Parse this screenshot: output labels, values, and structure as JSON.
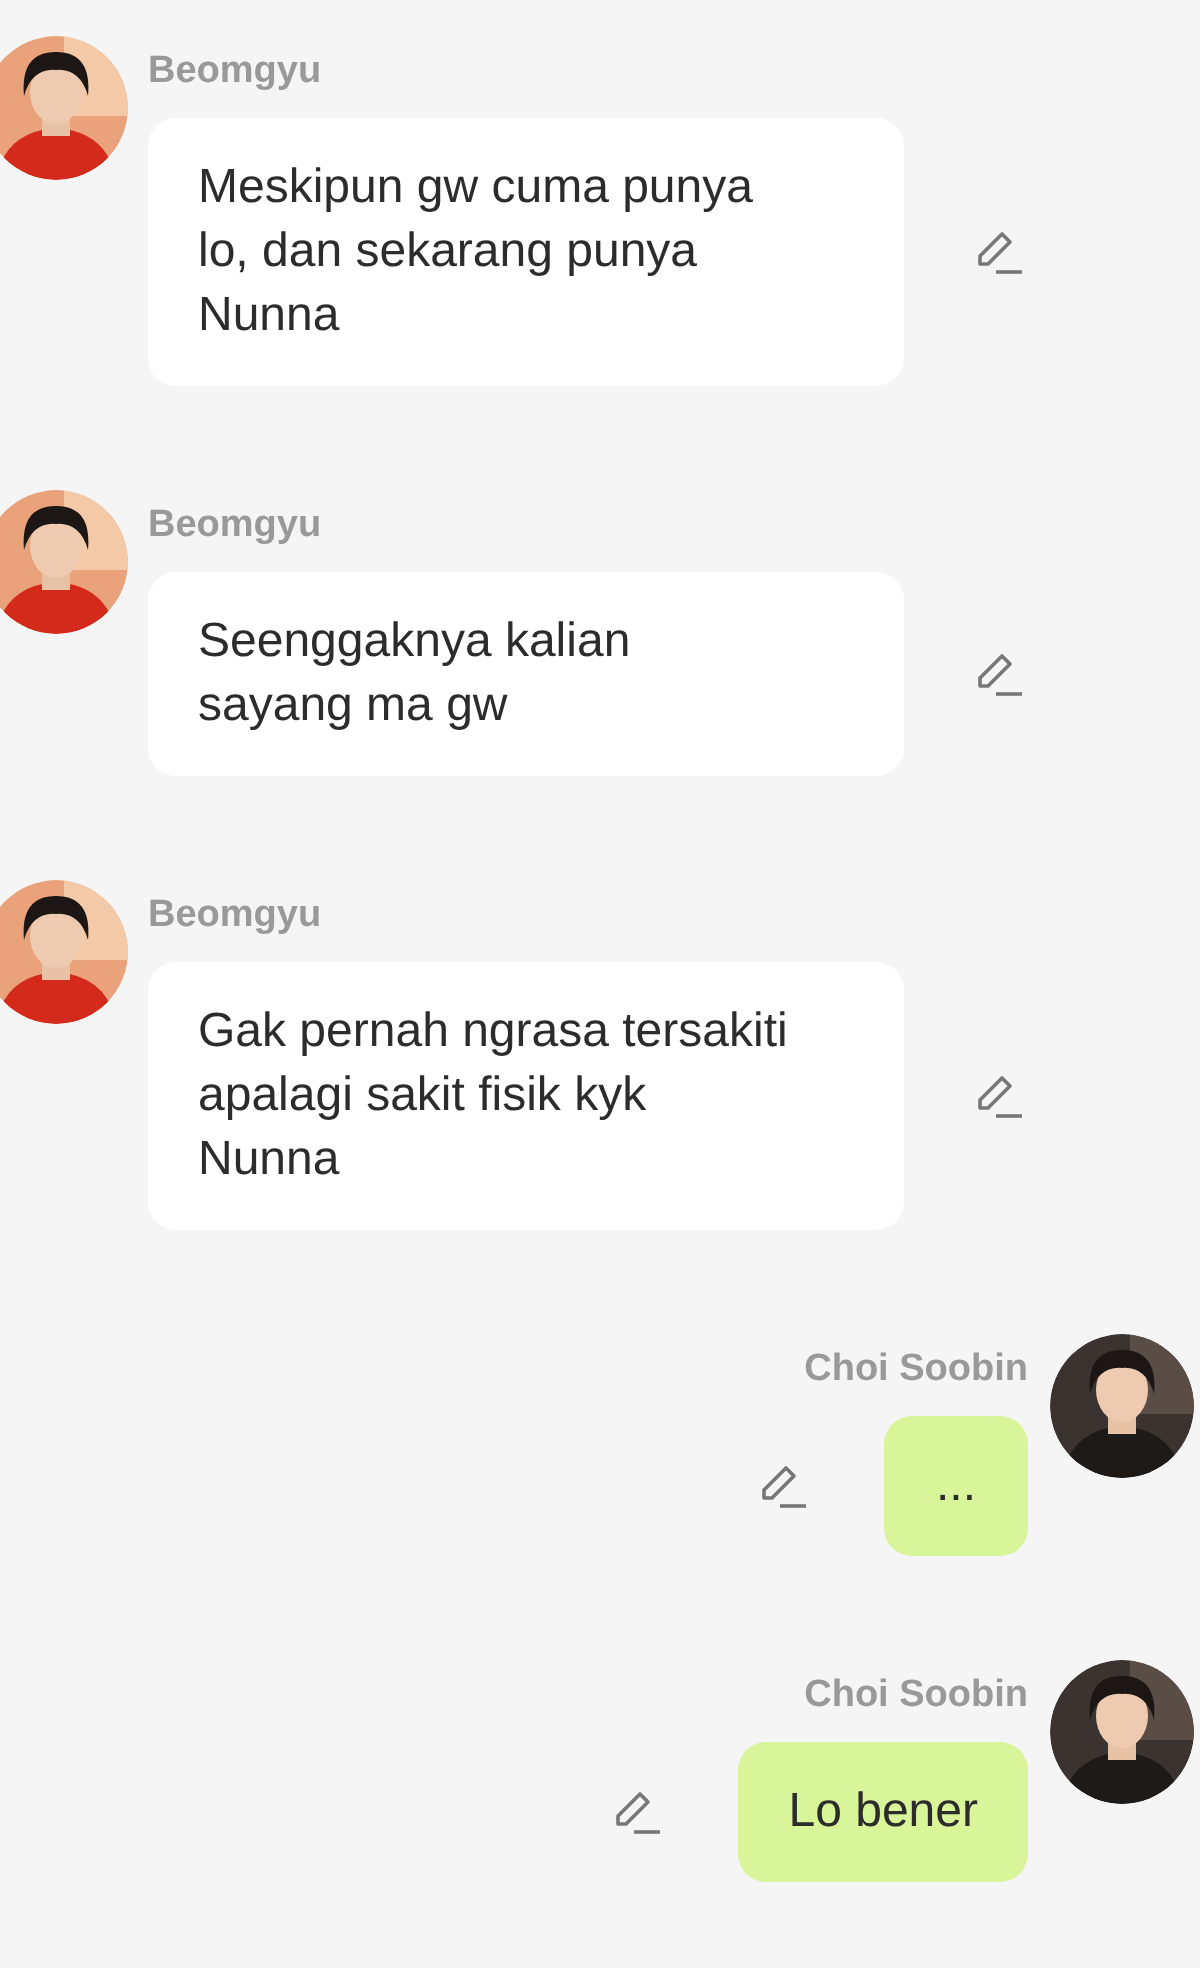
{
  "messages": [
    {
      "sender": "Beomgyu",
      "kind": "incoming",
      "text": "Meskipun gw cuma punya lo, dan sekarang punya Nunna"
    },
    {
      "sender": "Beomgyu",
      "kind": "incoming",
      "text": "Seenggaknya kalian sayang ma gw"
    },
    {
      "sender": "Beomgyu",
      "kind": "incoming",
      "text": "Gak pernah ngrasa tersakiti apalagi sakit fisik kyk Nunna"
    },
    {
      "sender": "Choi Soobin",
      "kind": "outgoing",
      "text": "..."
    },
    {
      "sender": "Choi Soobin",
      "kind": "outgoing",
      "text": "Lo bener"
    }
  ]
}
